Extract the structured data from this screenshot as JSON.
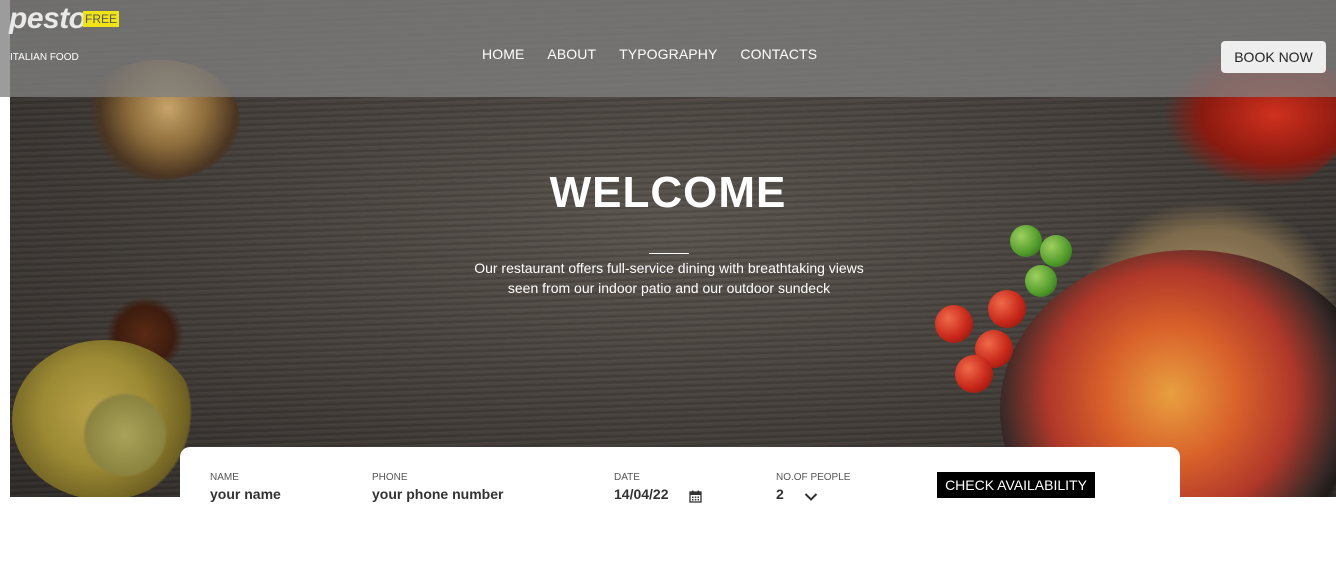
{
  "brand": {
    "name": "pesto",
    "badge": "FREE",
    "tagline": "ITALIAN FOOD"
  },
  "nav": {
    "items": [
      "HOME",
      "ABOUT",
      "TYPOGRAPHY",
      "CONTACTS"
    ]
  },
  "header": {
    "book_label": "BOOK NOW"
  },
  "hero": {
    "title": "WELCOME",
    "description_line1": "Our restaurant offers full-service dining with breathtaking views",
    "description_line2": "seen from our indoor patio and our outdoor sundeck"
  },
  "booking": {
    "name": {
      "label": "NAME",
      "value": "your name"
    },
    "phone": {
      "label": "PHONE",
      "value": "your phone number"
    },
    "date": {
      "label": "DATE",
      "value": "14/04/22"
    },
    "people": {
      "label": "NO.OF PEOPLE",
      "value": "2"
    },
    "check_label": "CHECK AVAILABILITY"
  },
  "icons": {
    "date": "calendar-icon",
    "people": "chevron-down-icon"
  },
  "colors": {
    "header_bg": "#808080",
    "badge": "#f0e416",
    "check_button": "#000000"
  }
}
